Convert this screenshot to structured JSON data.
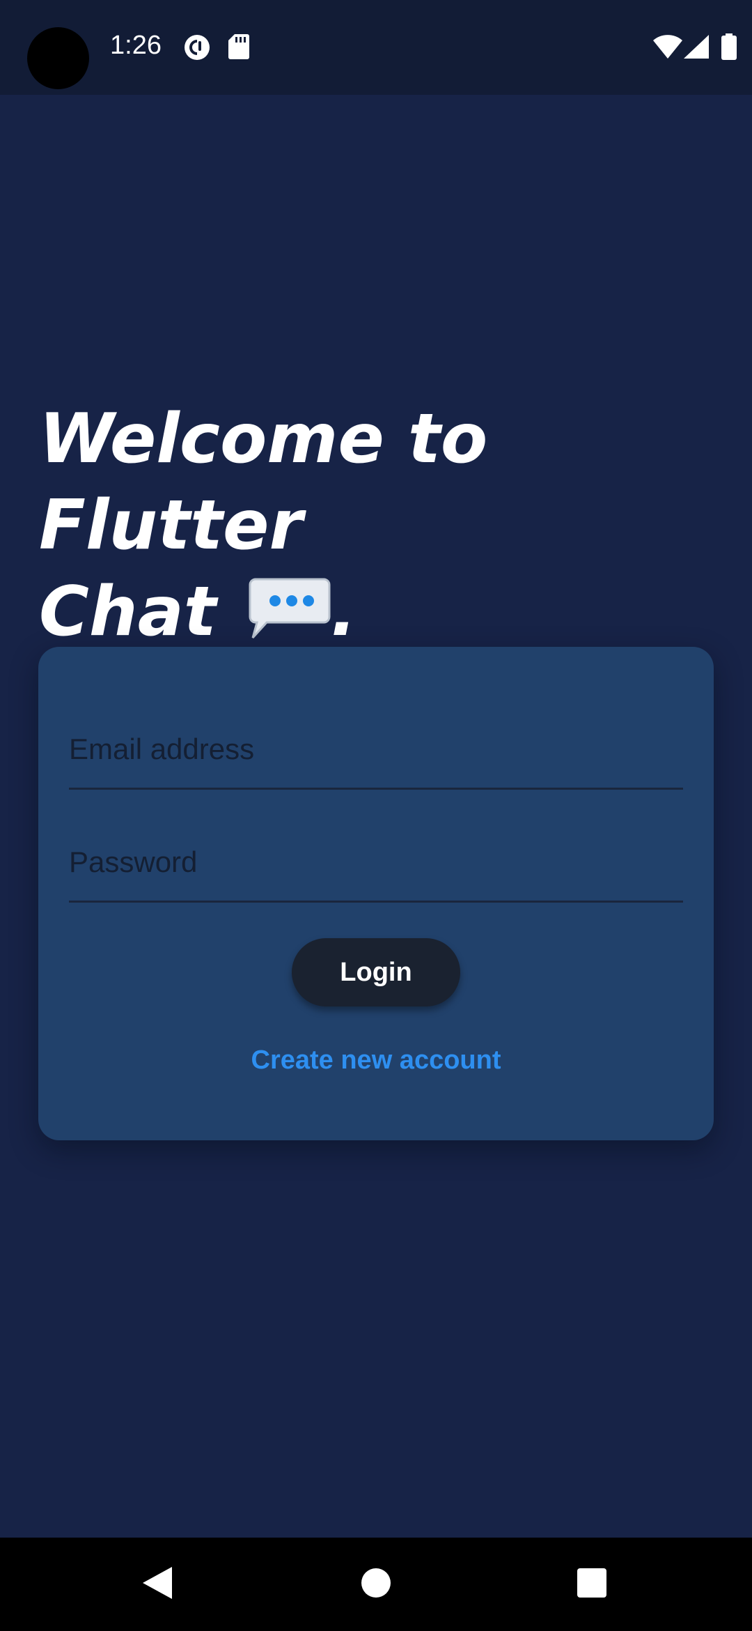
{
  "status_bar": {
    "time": "1:26",
    "icons": [
      "pocket-casts-icon",
      "sd-card-icon",
      "wifi-icon",
      "cellular-signal-icon",
      "battery-icon"
    ]
  },
  "welcome": {
    "line1": "Welcome to Flutter",
    "line2": "Chat",
    "icon": "speech-bubble-icon",
    "trailing": "."
  },
  "login_form": {
    "email_placeholder": "Email address",
    "email_value": "",
    "password_placeholder": "Password",
    "password_value": "",
    "login_label": "Login",
    "create_account_label": "Create new account"
  },
  "nav_bar": {
    "icons": [
      "back-icon",
      "home-icon",
      "recents-icon"
    ]
  },
  "colors": {
    "background": "#172347",
    "status_bar": "#121c36",
    "card": "#21416b",
    "button": "#1a2230",
    "link": "#2e8ff0",
    "text_primary": "#ffffff"
  }
}
